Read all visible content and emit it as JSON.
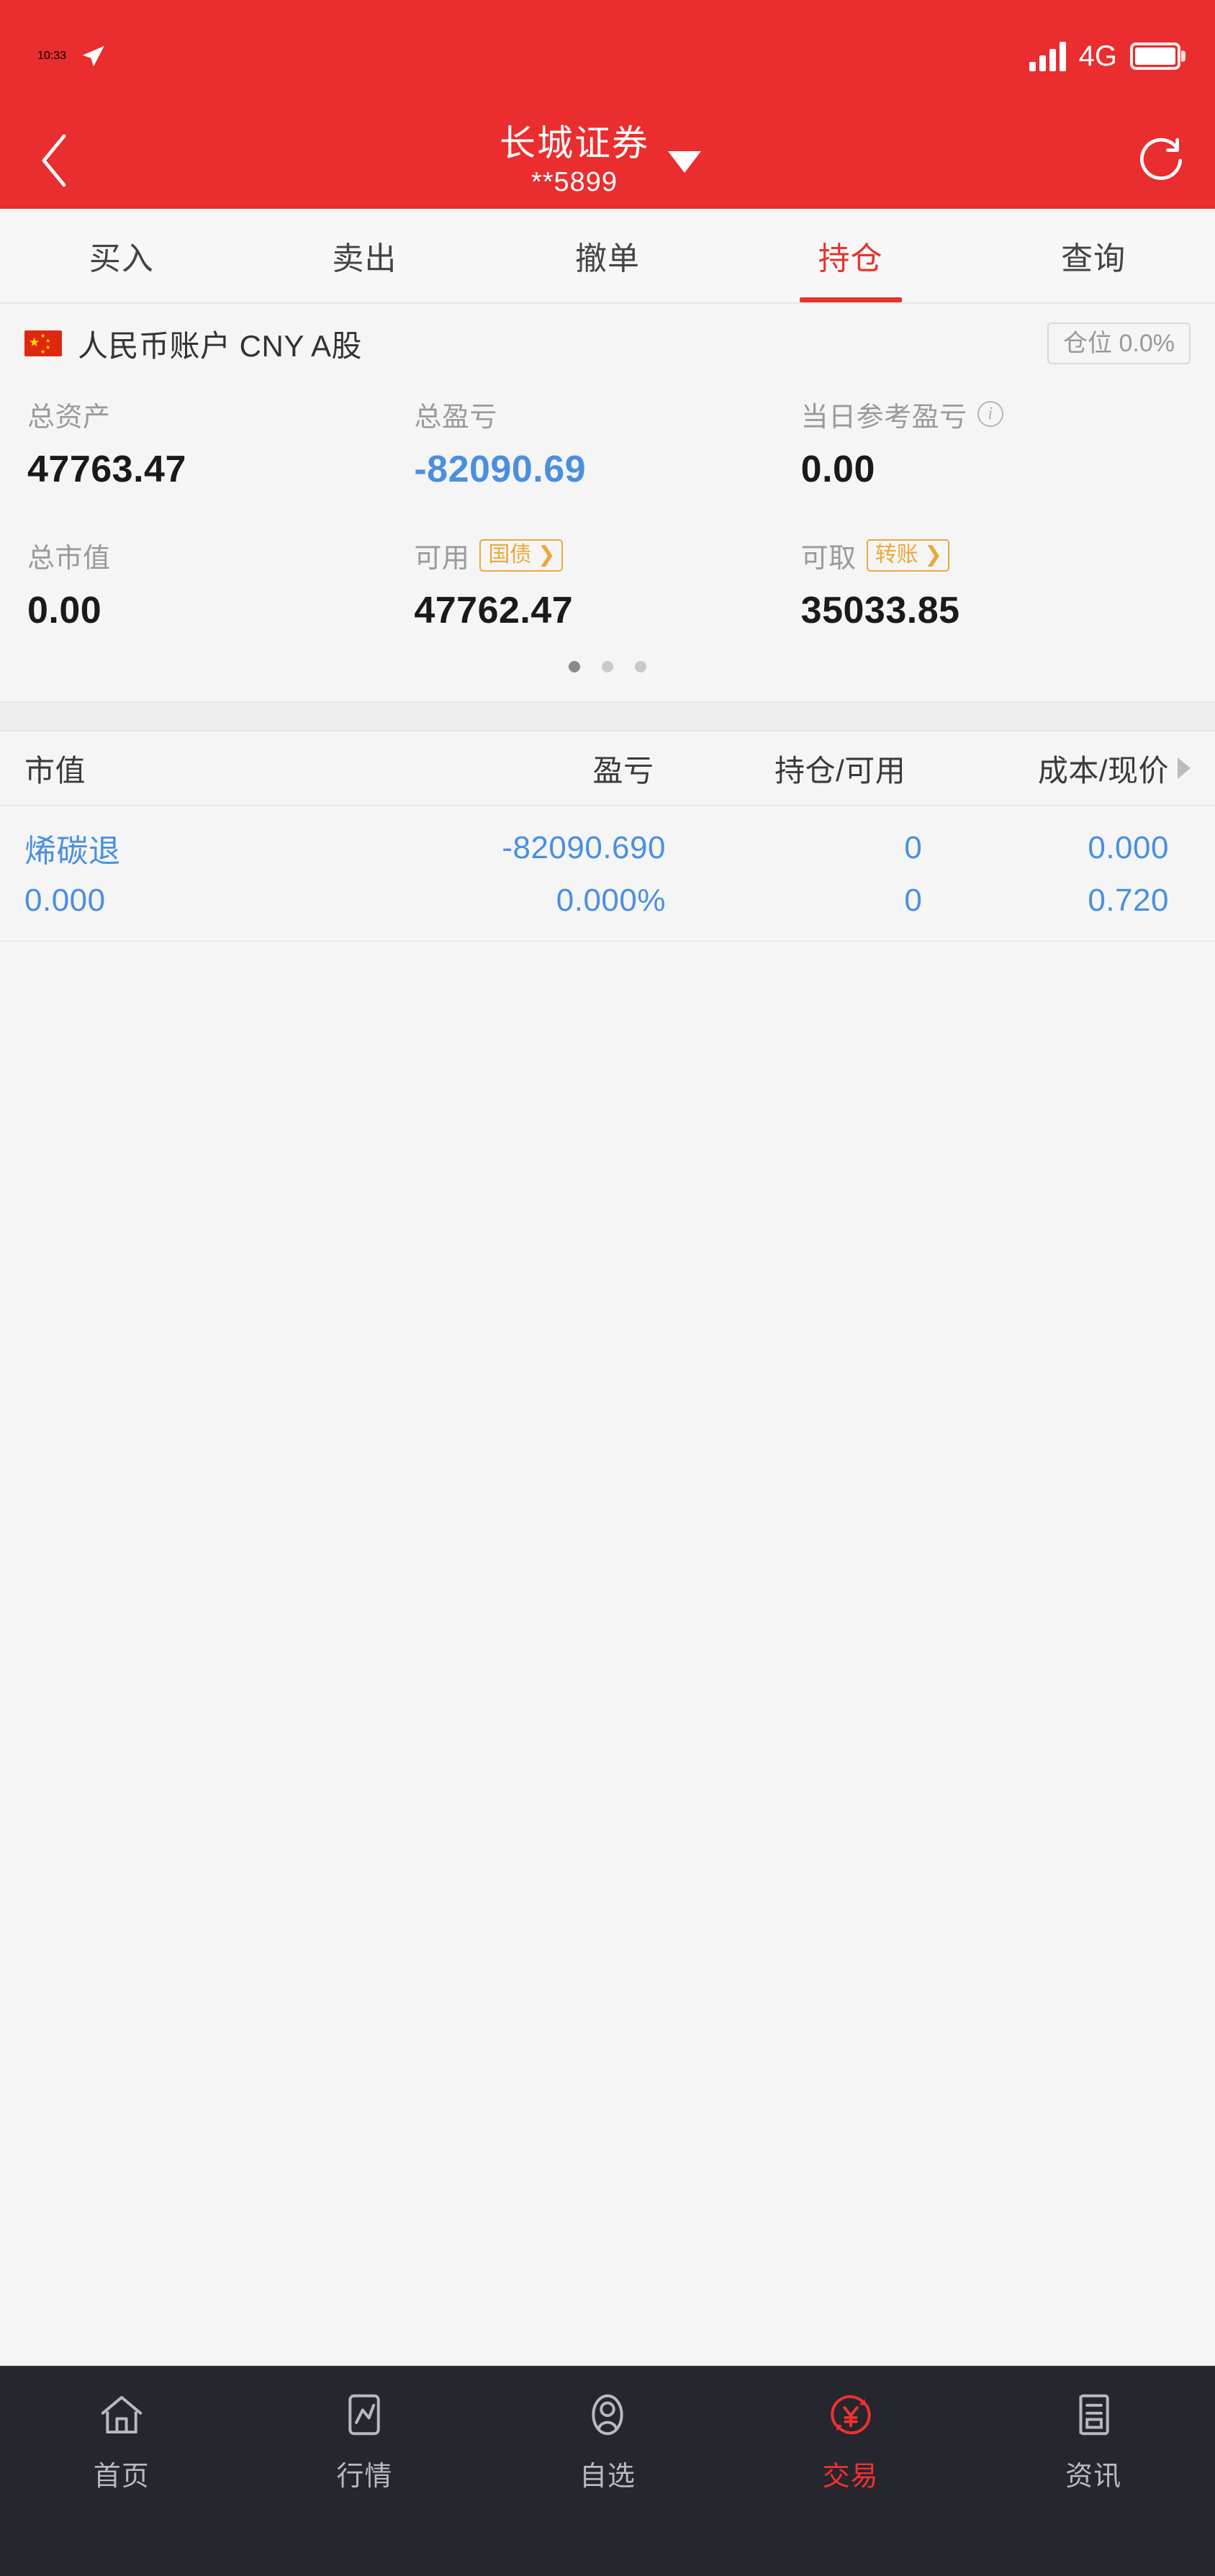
{
  "status_bar": {
    "time": "10:33",
    "location_icon": "location-arrow-icon",
    "signal_icon": "signal-bars-icon",
    "network": "4G",
    "battery_icon": "battery-full-icon"
  },
  "header": {
    "back_icon": "back-chevron-icon",
    "title": "长城证券",
    "subtitle": "**5899",
    "dropdown_icon": "caret-down-icon",
    "refresh_icon": "refresh-icon",
    "background_color": "#ea2d2e"
  },
  "tabs": {
    "active_index": 3,
    "accent_color": "#e3352e",
    "items": [
      {
        "label": "买入"
      },
      {
        "label": "卖出"
      },
      {
        "label": "撤单"
      },
      {
        "label": "持仓"
      },
      {
        "label": "查询"
      }
    ]
  },
  "account": {
    "flag_icon": "china-flag-icon",
    "name": "人民币账户 CNY A股",
    "position_badge": "仓位 0.0%"
  },
  "summary": {
    "row1": [
      {
        "label": "总资产",
        "value": "47763.47",
        "color": "#1a1a1a",
        "info_icon": null,
        "chip": null
      },
      {
        "label": "总盈亏",
        "value": "-82090.69",
        "color": "#4a8fe0",
        "info_icon": null,
        "chip": null
      },
      {
        "label": "当日参考盈亏",
        "value": "0.00",
        "color": "#1a1a1a",
        "info_icon": "info-circle-icon",
        "chip": null
      }
    ],
    "row2": [
      {
        "label": "总市值",
        "value": "0.00",
        "color": "#1a1a1a",
        "info_icon": null,
        "chip": null
      },
      {
        "label": "可用",
        "value": "47762.47",
        "color": "#1a1a1a",
        "info_icon": null,
        "chip": "国债 ❯"
      },
      {
        "label": "可取",
        "value": "35033.85",
        "color": "#1a1a1a",
        "info_icon": null,
        "chip": "转账 ❯"
      }
    ],
    "chip_color": "#e9a93c"
  },
  "pagination": {
    "total": 3,
    "active_index": 0
  },
  "holdings_table": {
    "headers": [
      "市值",
      "盈亏",
      "持仓/可用",
      "成本/现价"
    ],
    "scroll_hint_icon": "chevron-right-icon",
    "rows": [
      {
        "name": "烯碳退",
        "market_value": "0.000",
        "profit_loss": "-82090.690",
        "profit_loss_pct": "0.000%",
        "holding_qty": "0",
        "available_qty": "0",
        "cost_price": "0.000",
        "current_price": "0.720",
        "color": "#4a8fe0"
      }
    ]
  },
  "bottom_nav": {
    "active_index": 3,
    "accent_color": "#f0322c",
    "items": [
      {
        "label": "首页",
        "icon": "home-icon"
      },
      {
        "label": "行情",
        "icon": "market-chart-icon"
      },
      {
        "label": "自选",
        "icon": "watchlist-person-icon"
      },
      {
        "label": "交易",
        "icon": "trade-yuan-icon"
      },
      {
        "label": "资讯",
        "icon": "news-icon"
      }
    ]
  }
}
